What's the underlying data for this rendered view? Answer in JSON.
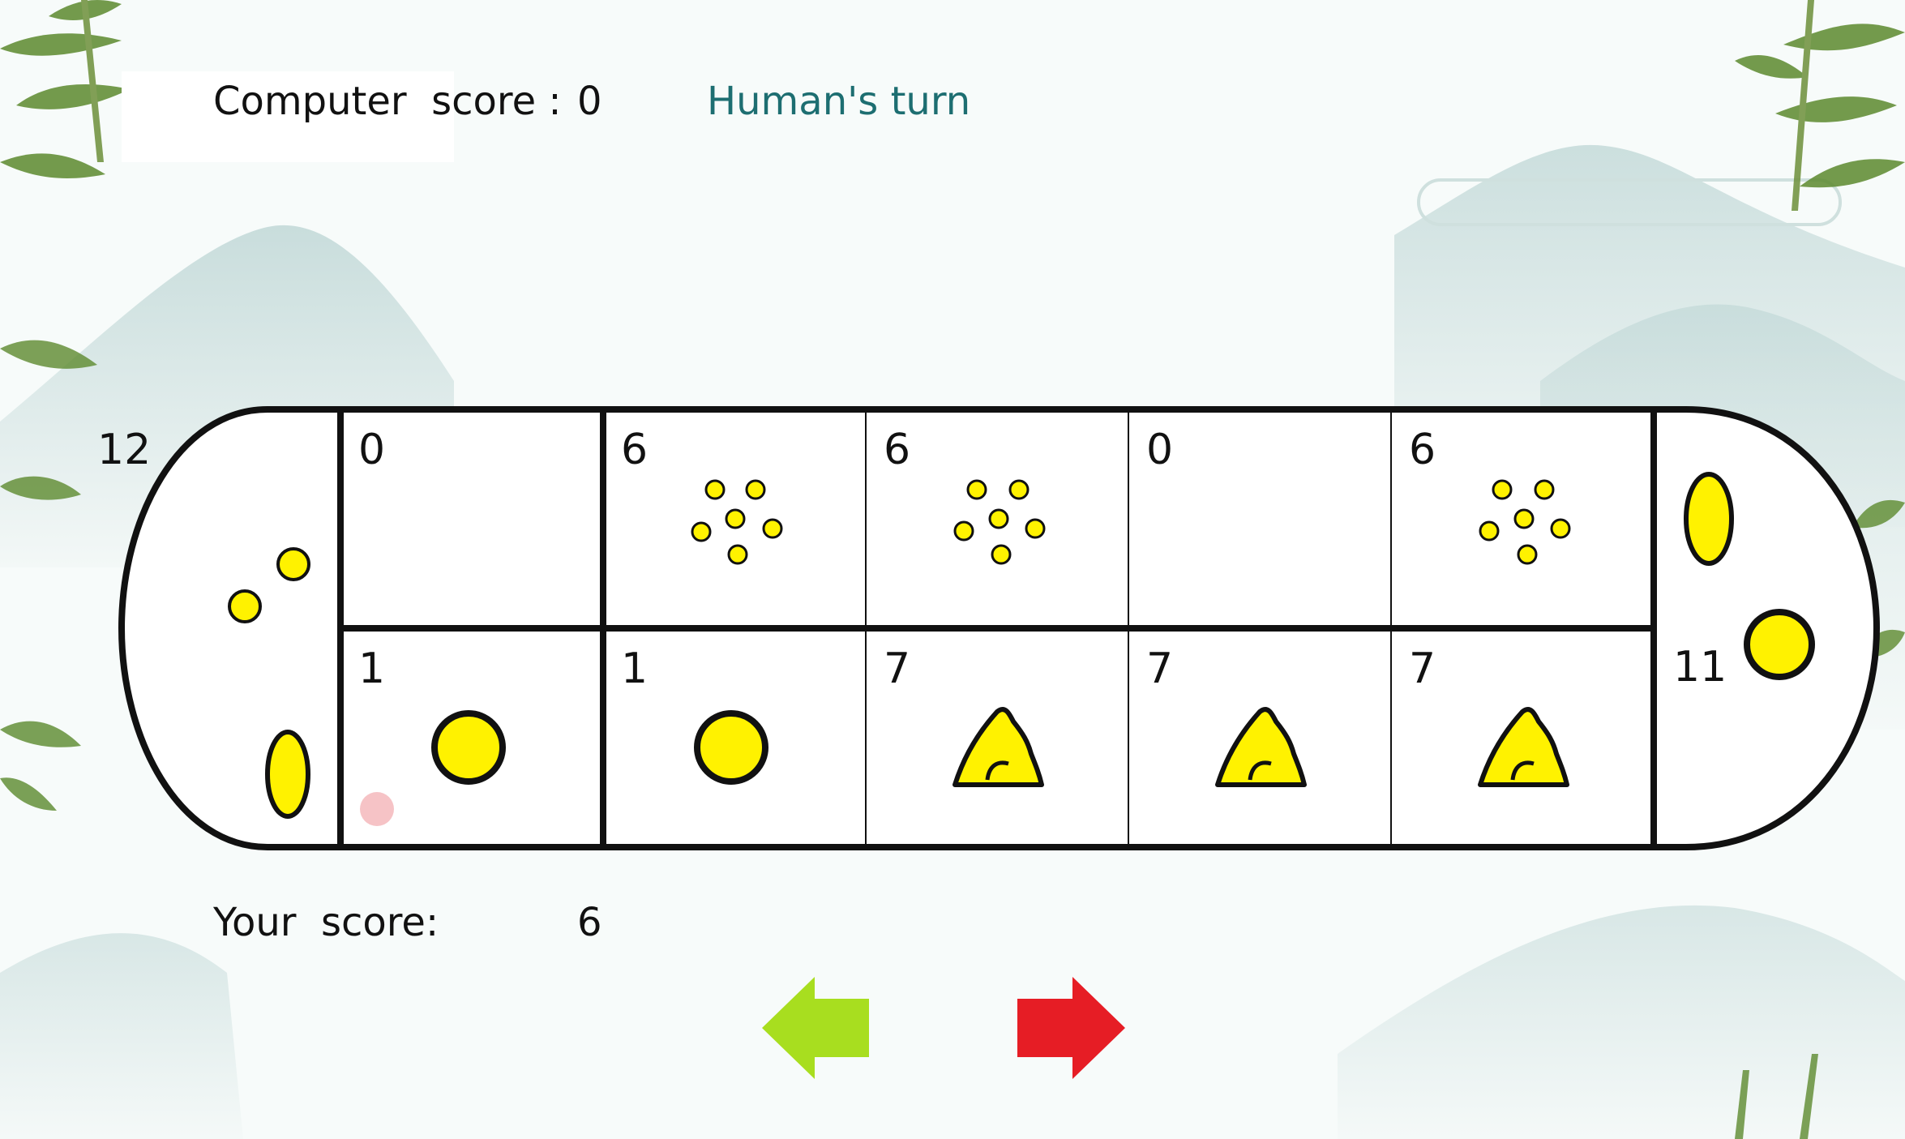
{
  "header": {
    "computer_score_label": "Computer  score :",
    "computer_score_value": "0",
    "turn_status": "Human's turn"
  },
  "footer": {
    "your_score_label": "Your  score:",
    "your_score_value": "6"
  },
  "board": {
    "left_store_count": "12",
    "right_store_count": "11",
    "top_row_counts": [
      "0",
      "6",
      "6",
      "0",
      "6"
    ],
    "bottom_row_counts": [
      "1",
      "1",
      "7",
      "7",
      "7"
    ]
  },
  "controls": {
    "left_arrow_color": "#a8de1f",
    "right_arrow_color": "#e61d25"
  },
  "colors": {
    "stone_yellow": "#fff200",
    "outline_black": "#111111",
    "turn_teal": "#1d6e71",
    "marker_pink": "#f5b8bc"
  }
}
